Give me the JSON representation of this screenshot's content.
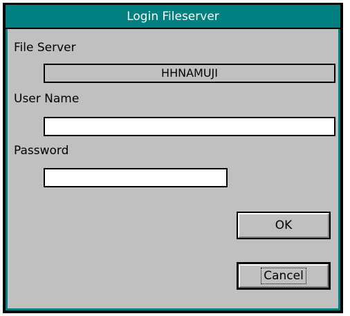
{
  "window": {
    "title": "Login Fileserver"
  },
  "form": {
    "file_server": {
      "label": "File Server",
      "value": "HHNAMUJI"
    },
    "user_name": {
      "label": "User Name",
      "value": ""
    },
    "password": {
      "label": "Password",
      "value": ""
    }
  },
  "buttons": {
    "ok": "OK",
    "cancel": "Cancel"
  },
  "colors": {
    "title_bar": "#008080",
    "dialog_face": "#c0c0c0"
  }
}
